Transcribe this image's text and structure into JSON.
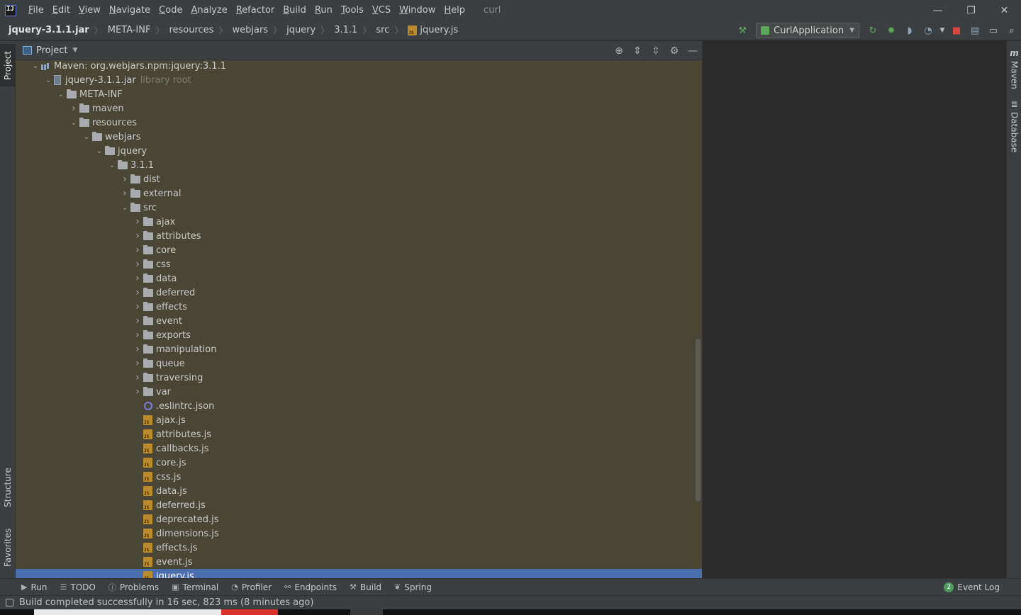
{
  "window": {
    "menu": [
      "File",
      "Edit",
      "View",
      "Navigate",
      "Code",
      "Analyze",
      "Refactor",
      "Build",
      "Run",
      "Tools",
      "VCS",
      "Window",
      "Help"
    ],
    "project_name": "curl",
    "minimize": "—",
    "restore": "❐",
    "close": "✕"
  },
  "breadcrumb": [
    "jquery-3.1.1.jar",
    "META-INF",
    "resources",
    "webjars",
    "jquery",
    "3.1.1",
    "src",
    "jquery.js"
  ],
  "run_config": {
    "label": "CurlApplication"
  },
  "left_tabs": {
    "project": "Project",
    "structure": "Structure",
    "favorites": "Favorites"
  },
  "right_tabs": {
    "maven": "Maven",
    "database": "Database"
  },
  "panel": {
    "title": "Project"
  },
  "tree": [
    {
      "label": "Maven: org.webjars.npm:jquery:3.1.1",
      "depth": 1,
      "arrow": "open",
      "icon": "library"
    },
    {
      "label": "jquery-3.1.1.jar",
      "suffix": "library root",
      "depth": 2,
      "arrow": "open",
      "icon": "jar"
    },
    {
      "label": "META-INF",
      "depth": 3,
      "arrow": "open",
      "icon": "folder"
    },
    {
      "label": "maven",
      "depth": 4,
      "arrow": "closed",
      "icon": "folder"
    },
    {
      "label": "resources",
      "depth": 4,
      "arrow": "open",
      "icon": "folder"
    },
    {
      "label": "webjars",
      "depth": 5,
      "arrow": "open",
      "icon": "folder"
    },
    {
      "label": "jquery",
      "depth": 6,
      "arrow": "open",
      "icon": "folder"
    },
    {
      "label": "3.1.1",
      "depth": 7,
      "arrow": "open",
      "icon": "folder"
    },
    {
      "label": "dist",
      "depth": 8,
      "arrow": "closed",
      "icon": "folder"
    },
    {
      "label": "external",
      "depth": 8,
      "arrow": "closed",
      "icon": "folder"
    },
    {
      "label": "src",
      "depth": 8,
      "arrow": "open",
      "icon": "folder"
    },
    {
      "label": "ajax",
      "depth": 9,
      "arrow": "closed",
      "icon": "folder"
    },
    {
      "label": "attributes",
      "depth": 9,
      "arrow": "closed",
      "icon": "folder"
    },
    {
      "label": "core",
      "depth": 9,
      "arrow": "closed",
      "icon": "folder"
    },
    {
      "label": "css",
      "depth": 9,
      "arrow": "closed",
      "icon": "folder"
    },
    {
      "label": "data",
      "depth": 9,
      "arrow": "closed",
      "icon": "folder"
    },
    {
      "label": "deferred",
      "depth": 9,
      "arrow": "closed",
      "icon": "folder"
    },
    {
      "label": "effects",
      "depth": 9,
      "arrow": "closed",
      "icon": "folder"
    },
    {
      "label": "event",
      "depth": 9,
      "arrow": "closed",
      "icon": "folder"
    },
    {
      "label": "exports",
      "depth": 9,
      "arrow": "closed",
      "icon": "folder"
    },
    {
      "label": "manipulation",
      "depth": 9,
      "arrow": "closed",
      "icon": "folder"
    },
    {
      "label": "queue",
      "depth": 9,
      "arrow": "closed",
      "icon": "folder"
    },
    {
      "label": "traversing",
      "depth": 9,
      "arrow": "closed",
      "icon": "folder"
    },
    {
      "label": "var",
      "depth": 9,
      "arrow": "closed",
      "icon": "folder"
    },
    {
      "label": ".eslintrc.json",
      "depth": 9,
      "arrow": "none",
      "icon": "eslint"
    },
    {
      "label": "ajax.js",
      "depth": 9,
      "arrow": "none",
      "icon": "js"
    },
    {
      "label": "attributes.js",
      "depth": 9,
      "arrow": "none",
      "icon": "js"
    },
    {
      "label": "callbacks.js",
      "depth": 9,
      "arrow": "none",
      "icon": "js"
    },
    {
      "label": "core.js",
      "depth": 9,
      "arrow": "none",
      "icon": "js"
    },
    {
      "label": "css.js",
      "depth": 9,
      "arrow": "none",
      "icon": "js"
    },
    {
      "label": "data.js",
      "depth": 9,
      "arrow": "none",
      "icon": "js"
    },
    {
      "label": "deferred.js",
      "depth": 9,
      "arrow": "none",
      "icon": "js"
    },
    {
      "label": "deprecated.js",
      "depth": 9,
      "arrow": "none",
      "icon": "js"
    },
    {
      "label": "dimensions.js",
      "depth": 9,
      "arrow": "none",
      "icon": "js"
    },
    {
      "label": "effects.js",
      "depth": 9,
      "arrow": "none",
      "icon": "js"
    },
    {
      "label": "event.js",
      "depth": 9,
      "arrow": "none",
      "icon": "js"
    },
    {
      "label": "jquery.js",
      "depth": 9,
      "arrow": "none",
      "icon": "js",
      "selected": true
    }
  ],
  "bottom_tools": {
    "run": "Run",
    "todo": "TODO",
    "problems": "Problems",
    "terminal": "Terminal",
    "profiler": "Profiler",
    "endpoints": "Endpoints",
    "build": "Build",
    "spring": "Spring",
    "event_log_count": "2",
    "event_log": "Event Log"
  },
  "status": {
    "message": "Build completed successfully in 16 sec, 823 ms (8 minutes ago)"
  },
  "colors": {
    "panel_bg": "#4a4636",
    "selection": "#4b6eaf",
    "chrome": "#3c3f41",
    "editor_bg": "#2b2b2b"
  }
}
